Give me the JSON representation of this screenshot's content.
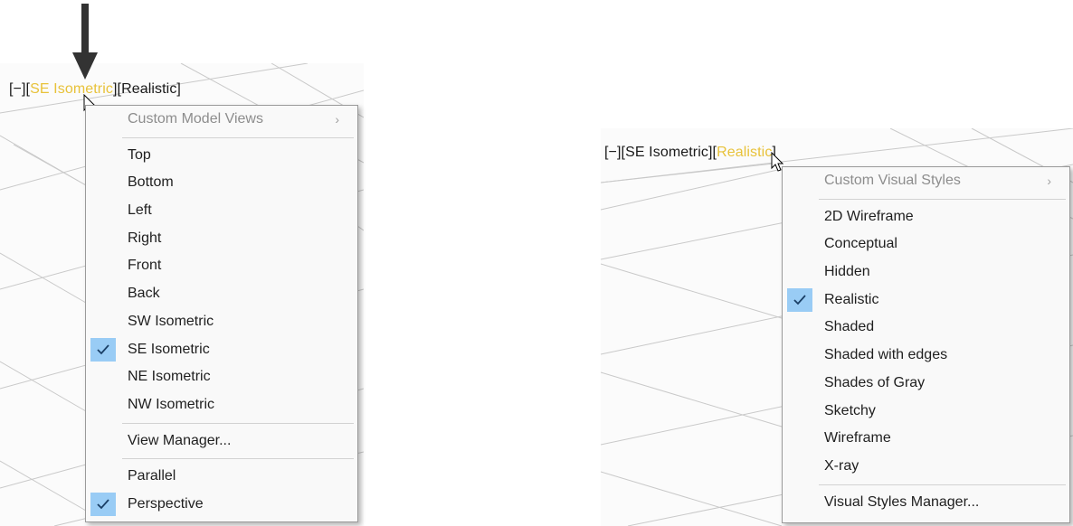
{
  "left_viewport": {
    "label": {
      "minimize": "[−]",
      "open_bracket": "[",
      "view": "SE Isometric",
      "close_bracket": "]",
      "style": "[Realistic]"
    },
    "menu": {
      "header": "Custom Model Views",
      "groups": [
        [
          {
            "label": "Top",
            "checked": false
          },
          {
            "label": "Bottom",
            "checked": false
          },
          {
            "label": "Left",
            "checked": false
          },
          {
            "label": "Right",
            "checked": false
          },
          {
            "label": "Front",
            "checked": false
          },
          {
            "label": "Back",
            "checked": false
          },
          {
            "label": "SW Isometric",
            "checked": false
          },
          {
            "label": "SE Isometric",
            "checked": true
          },
          {
            "label": "NE Isometric",
            "checked": false
          },
          {
            "label": "NW Isometric",
            "checked": false
          }
        ],
        [
          {
            "label": "View Manager...",
            "checked": false
          }
        ],
        [
          {
            "label": "Parallel",
            "checked": false
          },
          {
            "label": "Perspective",
            "checked": true
          }
        ]
      ]
    }
  },
  "right_viewport": {
    "label": {
      "minimize": "[−]",
      "view": "[SE Isometric]",
      "open_bracket": "[",
      "style": "Realistic",
      "close_bracket": "]"
    },
    "menu": {
      "header": "Custom Visual Styles",
      "groups": [
        [
          {
            "label": "2D Wireframe",
            "checked": false
          },
          {
            "label": "Conceptual",
            "checked": false
          },
          {
            "label": "Hidden",
            "checked": false
          },
          {
            "label": "Realistic",
            "checked": true
          },
          {
            "label": "Shaded",
            "checked": false
          },
          {
            "label": "Shaded with edges",
            "checked": false
          },
          {
            "label": "Shades of Gray",
            "checked": false
          },
          {
            "label": "Sketchy",
            "checked": false
          },
          {
            "label": "Wireframe",
            "checked": false
          },
          {
            "label": "X-ray",
            "checked": false
          }
        ],
        [
          {
            "label": "Visual Styles Manager...",
            "checked": false
          }
        ]
      ]
    }
  },
  "colors": {
    "highlight": "#e8c23a",
    "check_bg": "#99ccf5",
    "menu_bg": "#f9f9f9"
  },
  "icons": {
    "submenu": "chevron-right-icon",
    "check": "checkmark-icon",
    "pointer": "mouse-pointer-icon",
    "annotation": "down-arrow-icon"
  }
}
